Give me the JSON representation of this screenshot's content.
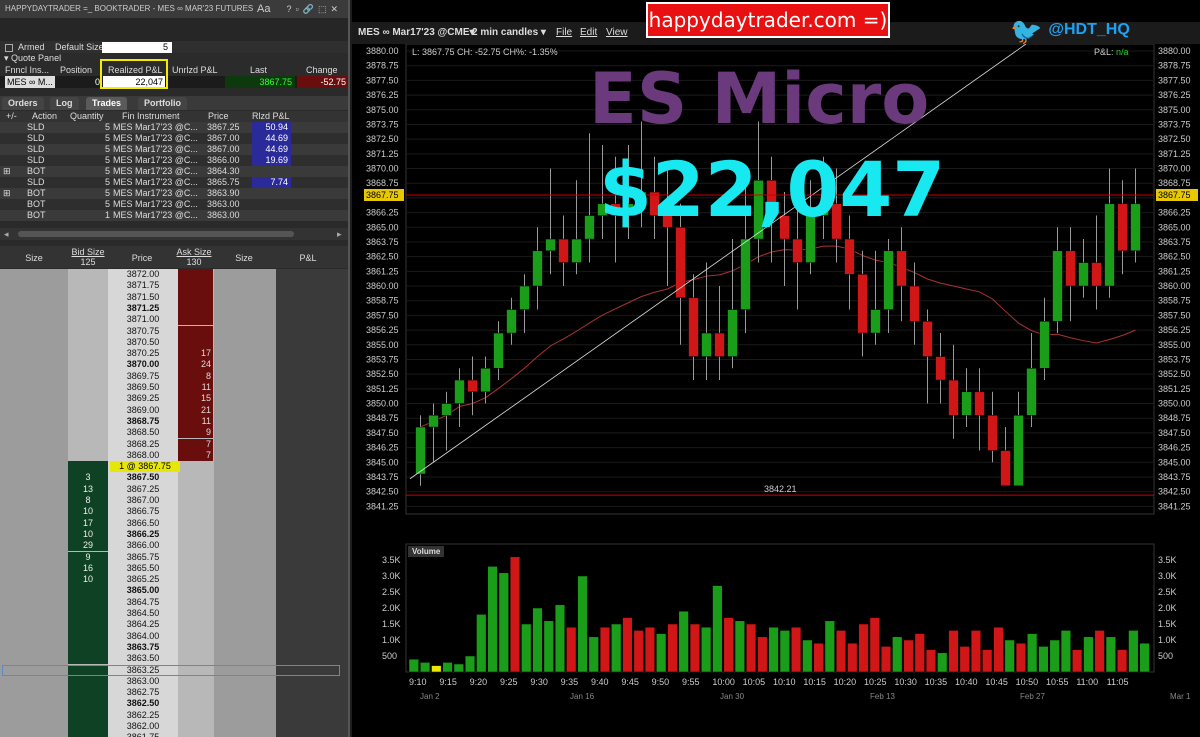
{
  "window_title": "HAPPYDAYTRADER =_ BOOKTRADER - MES ∞ MAR'23 FUTURES",
  "aa": "Aa",
  "armed_label": "Armed",
  "default_size_label": "Default Size",
  "default_size_value": "5",
  "quote_panel_label": "Quote Panel",
  "quote_headers": [
    "Fnncl Ins...",
    "Position",
    "Realized P&L",
    "Unrlzd P&L",
    "Last",
    "Change"
  ],
  "quote_row": {
    "instrument": "MES ∞ M...",
    "position": "0",
    "realized": "22,047",
    "unrealized": "",
    "last": "3867.75",
    "change": "-52.75"
  },
  "tabs": [
    "Orders",
    "Log",
    "Trades",
    "Portfolio"
  ],
  "trade_headers": [
    "+/-",
    "Action",
    "Quantity",
    "Fin Instrument",
    "Price",
    "Rlzd P&L"
  ],
  "trades": [
    {
      "exp": "",
      "action": "SLD",
      "qty": "5",
      "inst": "MES Mar17'23 @C...",
      "price": "3867.25",
      "pnl": "50.94"
    },
    {
      "exp": "",
      "action": "SLD",
      "qty": "5",
      "inst": "MES Mar17'23 @C...",
      "price": "3867.00",
      "pnl": "44.69"
    },
    {
      "exp": "",
      "action": "SLD",
      "qty": "5",
      "inst": "MES Mar17'23 @C...",
      "price": "3867.00",
      "pnl": "44.69"
    },
    {
      "exp": "",
      "action": "SLD",
      "qty": "5",
      "inst": "MES Mar17'23 @C...",
      "price": "3866.00",
      "pnl": "19.69"
    },
    {
      "exp": "⊞",
      "action": "BOT",
      "qty": "5",
      "inst": "MES Mar17'23 @C...",
      "price": "3864.30",
      "pnl": ""
    },
    {
      "exp": "",
      "action": "SLD",
      "qty": "5",
      "inst": "MES Mar17'23 @C...",
      "price": "3865.75",
      "pnl": "7.74"
    },
    {
      "exp": "⊞",
      "action": "BOT",
      "qty": "5",
      "inst": "MES Mar17'23 @C...",
      "price": "3863.90",
      "pnl": ""
    },
    {
      "exp": "",
      "action": "BOT",
      "qty": "5",
      "inst": "MES Mar17'23 @C...",
      "price": "3863.00",
      "pnl": ""
    },
    {
      "exp": "",
      "action": "BOT",
      "qty": "1",
      "inst": "MES Mar17'23 @C...",
      "price": "3863.00",
      "pnl": ""
    }
  ],
  "book_headers": {
    "size": "Size",
    "bid_size": "Bid Size",
    "bid_total": "125",
    "price": "Price",
    "ask_size": "Ask Size",
    "ask_total": "130",
    "size2": "Size",
    "pnl": "P&L"
  },
  "ladder": [
    {
      "p": "3872.00",
      "a": ""
    },
    {
      "p": "3871.75",
      "a": ""
    },
    {
      "p": "3871.50",
      "a": ""
    },
    {
      "p": "3871.25",
      "a": "",
      "b": 1
    },
    {
      "p": "3871.00",
      "a": ""
    },
    {
      "p": "3870.75",
      "a": ""
    },
    {
      "p": "3870.50",
      "a": ""
    },
    {
      "p": "3870.25",
      "a": "17"
    },
    {
      "p": "3870.00",
      "a": "24",
      "b": 1
    },
    {
      "p": "3869.75",
      "a": "8"
    },
    {
      "p": "3869.50",
      "a": "11"
    },
    {
      "p": "3869.25",
      "a": "15"
    },
    {
      "p": "3869.00",
      "a": "21"
    },
    {
      "p": "3868.75",
      "a": "11",
      "b": 1
    },
    {
      "p": "3868.50",
      "a": "9"
    },
    {
      "p": "3868.25",
      "a": "7"
    },
    {
      "p": "3868.00",
      "a": "7"
    },
    {
      "p": "1 @ 3867.75",
      "cur": 1
    },
    {
      "p": "3867.50",
      "bid": "3",
      "b": 1
    },
    {
      "p": "3867.25",
      "bid": "13"
    },
    {
      "p": "3867.00",
      "bid": "8"
    },
    {
      "p": "3866.75",
      "bid": "10"
    },
    {
      "p": "3866.50",
      "bid": "17"
    },
    {
      "p": "3866.25",
      "bid": "10",
      "b": 1
    },
    {
      "p": "3866.00",
      "bid": "29"
    },
    {
      "p": "3865.75",
      "bid": "9"
    },
    {
      "p": "3865.50",
      "bid": "16"
    },
    {
      "p": "3865.25",
      "bid": "10"
    },
    {
      "p": "3865.00",
      "b": 1
    },
    {
      "p": "3864.75"
    },
    {
      "p": "3864.50"
    },
    {
      "p": "3864.25"
    },
    {
      "p": "3864.00"
    },
    {
      "p": "3863.75",
      "b": 1
    },
    {
      "p": "3863.50"
    },
    {
      "p": "3863.25"
    },
    {
      "p": "3863.00"
    },
    {
      "p": "3862.75"
    },
    {
      "p": "3862.50",
      "b": 1
    },
    {
      "p": "3862.25"
    },
    {
      "p": "3862.00"
    },
    {
      "p": "3861.75"
    }
  ],
  "chart_header": {
    "symbol": "MES ∞ Mar17'23 @CME▾",
    "interval": "2 min candles ▾",
    "menu": [
      "File",
      "Edit",
      "View"
    ]
  },
  "info_line": "L: 3867.75 CH: -52.75 CH%: -1.35%",
  "pnl_label": "P&L:",
  "pnl_value": "n/a",
  "overlay_title": "ES Micro",
  "overlay_amount": "$22,047",
  "banner": "happydaytrader.com =)",
  "twitter": "@HDT_HQ",
  "chart_data": {
    "type": "candlestick",
    "y_ticks": [
      "3880.00",
      "3878.75",
      "3877.50",
      "3876.25",
      "3875.00",
      "3873.75",
      "3872.50",
      "3871.25",
      "3870.00",
      "3868.75",
      "3867.50",
      "3866.25",
      "3865.00",
      "3863.75",
      "3862.50",
      "3861.25",
      "3860.00",
      "3858.75",
      "3857.50",
      "3856.25",
      "3855.00",
      "3853.75",
      "3852.50",
      "3851.25",
      "3850.00",
      "3848.75",
      "3847.50",
      "3846.25",
      "3845.00",
      "3843.75",
      "3842.50",
      "3841.25"
    ],
    "ylim": [
      3840.6,
      3880.6
    ],
    "last_price_label": "3867.75",
    "last_price": 3867.75,
    "hline_label": "3842.21",
    "hline": 3842.21,
    "x_ticks": [
      "9:10",
      "9:15",
      "9:20",
      "9:25",
      "9:30",
      "9:35",
      "9:40",
      "9:45",
      "9:50",
      "9:55",
      "10:00",
      "10:05",
      "10:10",
      "10:15",
      "10:20",
      "10:25",
      "10:30",
      "10:35",
      "10:40",
      "10:45",
      "10:50",
      "10:55",
      "11:00",
      "11:05"
    ],
    "date_ticks": [
      "Jan 2",
      "Jan 16",
      "Jan 30",
      "Feb 13",
      "Feb 27",
      "Mar 1"
    ],
    "candles": [
      [
        3844,
        3848,
        3843,
        3849
      ],
      [
        3848,
        3849,
        3845,
        3850
      ],
      [
        3849,
        3850,
        3846,
        3851
      ],
      [
        3850,
        3852,
        3848,
        3853
      ],
      [
        3852,
        3851,
        3849,
        3854
      ],
      [
        3851,
        3853,
        3850,
        3854
      ],
      [
        3853,
        3856,
        3852,
        3857
      ],
      [
        3856,
        3858,
        3855,
        3859
      ],
      [
        3858,
        3860,
        3856,
        3861
      ],
      [
        3860,
        3863,
        3858,
        3865
      ],
      [
        3863,
        3864,
        3861,
        3870
      ],
      [
        3864,
        3862,
        3860,
        3866
      ],
      [
        3862,
        3864,
        3861,
        3869
      ],
      [
        3864,
        3866,
        3862,
        3873
      ],
      [
        3866,
        3867,
        3864,
        3872
      ],
      [
        3867,
        3866,
        3862,
        3871
      ],
      [
        3866,
        3867,
        3864,
        3872
      ],
      [
        3867,
        3868,
        3865,
        3874
      ],
      [
        3868,
        3866,
        3864,
        3871
      ],
      [
        3866,
        3865,
        3860,
        3870
      ],
      [
        3865,
        3859,
        3855,
        3867
      ],
      [
        3859,
        3854,
        3852,
        3861
      ],
      [
        3854,
        3856,
        3852,
        3862
      ],
      [
        3856,
        3854,
        3852,
        3860
      ],
      [
        3854,
        3858,
        3853,
        3864
      ],
      [
        3858,
        3864,
        3856,
        3870
      ],
      [
        3864,
        3869,
        3862,
        3874
      ],
      [
        3869,
        3866,
        3862,
        3871
      ],
      [
        3866,
        3864,
        3860,
        3868
      ],
      [
        3864,
        3862,
        3858,
        3867
      ],
      [
        3862,
        3866,
        3861,
        3869
      ],
      [
        3866,
        3867,
        3864,
        3871
      ],
      [
        3867,
        3864,
        3862,
        3870
      ],
      [
        3864,
        3861,
        3858,
        3866
      ],
      [
        3861,
        3856,
        3854,
        3863
      ],
      [
        3856,
        3858,
        3855,
        3863
      ],
      [
        3858,
        3863,
        3856,
        3864
      ],
      [
        3863,
        3860,
        3857,
        3865
      ],
      [
        3860,
        3857,
        3855,
        3862
      ],
      [
        3857,
        3854,
        3850,
        3858
      ],
      [
        3854,
        3852,
        3850,
        3856
      ],
      [
        3852,
        3849,
        3847,
        3855
      ],
      [
        3849,
        3851,
        3848,
        3853
      ],
      [
        3851,
        3849,
        3846,
        3853
      ],
      [
        3849,
        3846,
        3845,
        3851
      ],
      [
        3846,
        3843,
        3843,
        3848
      ],
      [
        3843,
        3849,
        3843,
        3851
      ],
      [
        3849,
        3853,
        3848,
        3856
      ],
      [
        3853,
        3857,
        3852,
        3859
      ],
      [
        3857,
        3863,
        3856,
        3865
      ],
      [
        3863,
        3860,
        3857,
        3865
      ],
      [
        3860,
        3862,
        3859,
        3864
      ],
      [
        3862,
        3860,
        3858,
        3866
      ],
      [
        3860,
        3867,
        3859,
        3870
      ],
      [
        3867,
        3863,
        3861,
        3869
      ],
      [
        3863,
        3867,
        3862,
        3870
      ]
    ],
    "volume_ticks": [
      "3.5K",
      "3.0K",
      "2.5K",
      "2.0K",
      "1.5K",
      "1.0K",
      "500"
    ],
    "volume_label": "Volume",
    "volume_ymax": 4000,
    "volumes": [
      [
        400,
        "g"
      ],
      [
        300,
        "g"
      ],
      [
        200,
        "y"
      ],
      [
        300,
        "g"
      ],
      [
        250,
        "g"
      ],
      [
        500,
        "g"
      ],
      [
        1800,
        "g"
      ],
      [
        3300,
        "g"
      ],
      [
        3100,
        "g"
      ],
      [
        3600,
        "r"
      ],
      [
        1500,
        "g"
      ],
      [
        2000,
        "g"
      ],
      [
        1600,
        "g"
      ],
      [
        2100,
        "g"
      ],
      [
        1400,
        "r"
      ],
      [
        3000,
        "g"
      ],
      [
        1100,
        "g"
      ],
      [
        1400,
        "r"
      ],
      [
        1500,
        "g"
      ],
      [
        1700,
        "r"
      ],
      [
        1300,
        "r"
      ],
      [
        1400,
        "r"
      ],
      [
        1200,
        "g"
      ],
      [
        1500,
        "r"
      ],
      [
        1900,
        "g"
      ],
      [
        1500,
        "r"
      ],
      [
        1400,
        "g"
      ],
      [
        2700,
        "g"
      ],
      [
        1700,
        "r"
      ],
      [
        1600,
        "g"
      ],
      [
        1500,
        "r"
      ],
      [
        1100,
        "r"
      ],
      [
        1400,
        "g"
      ],
      [
        1300,
        "g"
      ],
      [
        1400,
        "r"
      ],
      [
        1000,
        "g"
      ],
      [
        900,
        "r"
      ],
      [
        1600,
        "g"
      ],
      [
        1300,
        "r"
      ],
      [
        900,
        "r"
      ],
      [
        1500,
        "r"
      ],
      [
        1700,
        "r"
      ],
      [
        800,
        "r"
      ],
      [
        1100,
        "g"
      ],
      [
        1000,
        "r"
      ],
      [
        1200,
        "r"
      ],
      [
        700,
        "r"
      ],
      [
        600,
        "g"
      ],
      [
        1300,
        "r"
      ],
      [
        800,
        "r"
      ],
      [
        1300,
        "r"
      ],
      [
        700,
        "r"
      ],
      [
        1400,
        "r"
      ],
      [
        1000,
        "g"
      ],
      [
        900,
        "r"
      ],
      [
        1200,
        "g"
      ],
      [
        800,
        "g"
      ],
      [
        1000,
        "g"
      ],
      [
        1300,
        "g"
      ],
      [
        700,
        "r"
      ],
      [
        1100,
        "g"
      ],
      [
        1300,
        "r"
      ],
      [
        1100,
        "g"
      ],
      [
        700,
        "r"
      ],
      [
        1300,
        "g"
      ],
      [
        900,
        "g"
      ]
    ]
  }
}
